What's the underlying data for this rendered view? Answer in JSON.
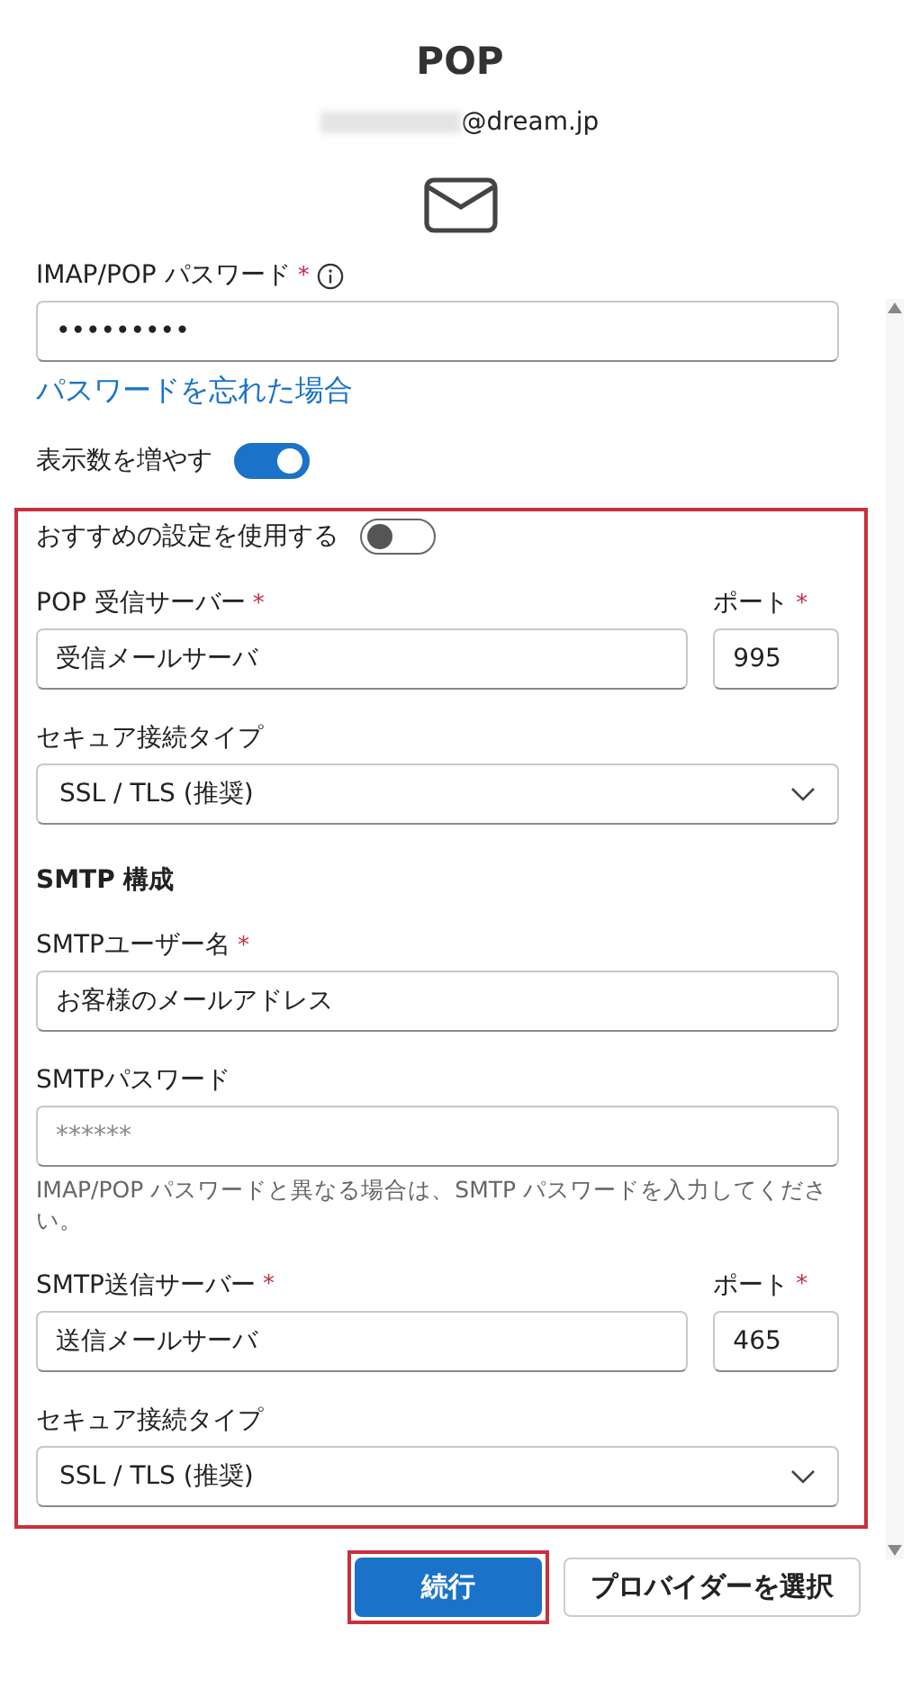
{
  "title": "POP",
  "account": {
    "email_suffix": "@dream.jp"
  },
  "password": {
    "label": "IMAP/POP パスワード",
    "required": "*",
    "value": "•••••••••"
  },
  "forgot_link": "パスワードを忘れた場合",
  "more_toggle": {
    "label": "表示数を増やす",
    "on": true
  },
  "settings": [
    {
      "kind": "toggle",
      "label": "おすすめの設定を使用する",
      "on": false
    },
    {
      "kind": "pair",
      "label": "POP 受信サーバー",
      "required": "*",
      "value": "受信メールサーバ",
      "port_label": "ポート",
      "port_required": "*",
      "port_value": "995"
    },
    {
      "kind": "select",
      "label": "セキュア接続タイプ",
      "value": "SSL / TLS (推奨)"
    },
    {
      "kind": "heading",
      "label": "SMTP 構成"
    },
    {
      "kind": "field",
      "label": "SMTPユーザー名",
      "required": "*",
      "value": "お客様のメールアドレス"
    },
    {
      "kind": "field",
      "label": "SMTPパスワード",
      "placeholder": "******",
      "help": "IMAP/POP パスワードと異なる場合は、SMTP パスワードを入力してください。"
    },
    {
      "kind": "pair",
      "label": "SMTP送信サーバー",
      "required": "*",
      "value": "送信メールサーバ",
      "port_label": "ポート",
      "port_required": "*",
      "port_value": "465"
    },
    {
      "kind": "select",
      "label": "セキュア接続タイプ",
      "value": "SSL / TLS (推奨)"
    }
  ],
  "buttons": [
    {
      "label": "続行",
      "kind": "primary"
    },
    {
      "label": "プロバイダーを選択",
      "kind": "secondary"
    }
  ]
}
